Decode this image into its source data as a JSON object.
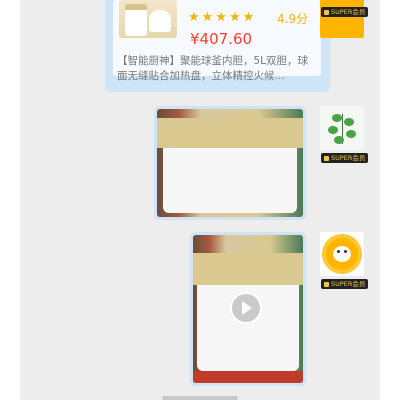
{
  "product": {
    "stars": "★★★★★",
    "rating": "4.9分",
    "price": "¥407.60",
    "description": "【智能厨神】聚能球釜内胆，5L双胆，球面无缝贴合加热盘，立体精控火候…"
  },
  "badges": {
    "label": "SUPER会员"
  },
  "colors": {
    "bubble": "#cfe4f7",
    "price": "#ff3b30",
    "stars": "#f4b400",
    "chat_background": "#ededed"
  }
}
